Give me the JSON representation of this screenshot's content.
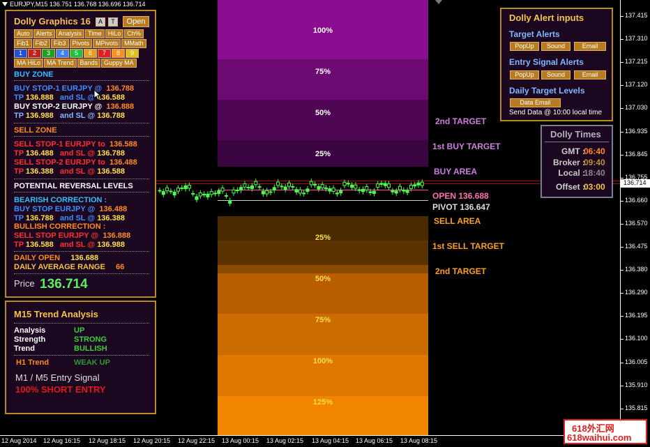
{
  "window": {
    "title": "EURJPY,M15  136.751 136.768 136.696 136.714"
  },
  "buy_bands": [
    {
      "label": "100%",
      "color": "#8a0f90"
    },
    {
      "label": "75%",
      "color": "#6c0a72"
    },
    {
      "label": "50%",
      "color": "#4f0755"
    },
    {
      "label": "25%",
      "color": "#3a0540"
    }
  ],
  "sell_bands": [
    {
      "label": "25%",
      "color": "#5a3300"
    },
    {
      "label": "50%",
      "color": "#b85e00"
    },
    {
      "label": "75%",
      "color": "#cc6c00"
    },
    {
      "label": "100%",
      "color": "#e07800"
    },
    {
      "label": "125%",
      "color": "#f28500"
    }
  ],
  "chart_labels": {
    "target2_top": "2nd TARGET",
    "buy_target1": "1st BUY TARGET",
    "buy_area": "BUY AREA",
    "open": "OPEN 136.688",
    "pivot": "PIVOT 136.647",
    "sell_area": "SELL AREA",
    "sell_target1": "1st SELL TARGET",
    "target2_bottom": "2nd TARGET"
  },
  "price_axis": {
    "labels": [
      "137.415",
      "137.310",
      "137.215",
      "137.120",
      "137.030",
      "136.935",
      "136.845",
      "136.755",
      "136.660",
      "136.570",
      "136.475",
      "136.380",
      "136.290",
      "136.195",
      "136.100",
      "136.005",
      "135.910",
      "135.815"
    ],
    "current": "136.714",
    "current_color": "#ff3030"
  },
  "time_axis": [
    "12 Aug 2014",
    "12 Aug 16:15",
    "12 Aug 18:15",
    "12 Aug 20:15",
    "12 Aug 22:15",
    "13 Aug 00:15",
    "13 Aug 02:15",
    "13 Aug 04:15",
    "13 Aug 06:15",
    "13 Aug 08:15"
  ],
  "dolly_panel": {
    "title": "Dolly Graphics 16",
    "btn_a": "A",
    "btn_t": "T",
    "btn_open": "Open",
    "row1": [
      "Auto",
      "Alerts",
      "Analysis",
      "Time",
      "HiLo",
      "Ch%"
    ],
    "row2": [
      "Fib1",
      "Fib2",
      "Fib3",
      "Pivots",
      "MPivots",
      "MMath"
    ],
    "nums": [
      "1",
      "2",
      "3",
      "4",
      "5",
      "6",
      "7",
      "8",
      "9"
    ],
    "num_colors": [
      "#2050e0",
      "#c02020",
      "#20a020",
      "#4080ff",
      "#20c040",
      "#e0a020",
      "#e02020",
      "#ff9020",
      "#e0c020"
    ],
    "row3": [
      "MA HiLo",
      "MA Trend",
      "Bands",
      "Guppy MA"
    ],
    "buy_zone": "BUY ZONE",
    "buy_stop1": "BUY STOP-1  EURJPY  @",
    "buy_stop1_val": "136.788",
    "tp1_label": "TP",
    "tp1_val": "136.888",
    "tp1_sl": "and SL @",
    "tp1_sl_val": "136.588",
    "buy_stop2": "BUY STOP-2  EURJPY  @",
    "buy_stop2_val": "136.888",
    "tp2_label": "TP",
    "tp2_val": "136.988",
    "tp2_sl": "and SL @",
    "tp2_sl_val": "136.788",
    "sell_zone": "SELL ZONE",
    "sell_stop1": "SELL STOP-1  EURJPY to",
    "sell_stop1_val": "136.588",
    "stp1_label": "TP",
    "stp1_val": "136.488",
    "stp1_sl": "and SL @",
    "stp1_sl_val": "136.788",
    "sell_stop2": "SELL STOP-2  EURJPY to",
    "sell_stop2_val": "136.488",
    "stp2_label": "TP",
    "stp2_val": "136.388",
    "stp2_sl": "and SL @",
    "stp2_sl_val": "136.588",
    "reversal": "POTENTIAL REVERSAL LEVELS",
    "bearish": "BEARISH CORRECTION :",
    "bear_buy": "BUY STOP EURJPY  @",
    "bear_buy_val": "136.488",
    "bear_tp": "TP",
    "bear_tp_val": "136.788",
    "bear_sl": "and SL @",
    "bear_sl_val": "136.388",
    "bullish": "BULLISH CORRECTION :",
    "bull_sell": "SELL STOP EURJPY  @",
    "bull_sell_val": "136.888",
    "bull_tp": "TP",
    "bull_tp_val": "136.588",
    "bull_sl": "and SL @",
    "bull_sl_val": "136.988",
    "daily_open": "DAILY OPEN",
    "daily_open_val": "136.688",
    "dar": "DAILY AVERAGE RANGE",
    "dar_val": "66",
    "price_label": "Price",
    "price_val": "136.714"
  },
  "trend_panel": {
    "title": "M15 Trend Analysis",
    "analysis": "Analysis",
    "analysis_val": "UP",
    "strength": "Strength",
    "strength_val": "STRONG",
    "trend": "Trend",
    "trend_val": "BULLISH",
    "h1": "H1 Trend",
    "h1_val": "WEAK UP",
    "m1m5": "M1 /  M5 Entry Signal",
    "signal": "100% SHORT ENTRY"
  },
  "alert_panel": {
    "title": "Dolly Alert inputs",
    "target_alerts": "Target Alerts",
    "entry_alerts": "Entry Signal Alerts",
    "popup": "PopUp",
    "sound": "Sound",
    "email": "Email",
    "daily_levels": "Daily Target Levels",
    "data_email": "Data Email",
    "send_data": "Send Data @ 10:00 local time"
  },
  "times_panel": {
    "title": "Dolly Times",
    "gmt": "GMT :",
    "gmt_val": "06:40",
    "broker": "Broker :",
    "broker_val": "09:40",
    "local": "Local :",
    "local_val": "18:40",
    "offset": "Offset :",
    "offset_val": "03:00"
  },
  "watermark": {
    "line1": "618外汇网",
    "line2": "618waihui.com"
  }
}
